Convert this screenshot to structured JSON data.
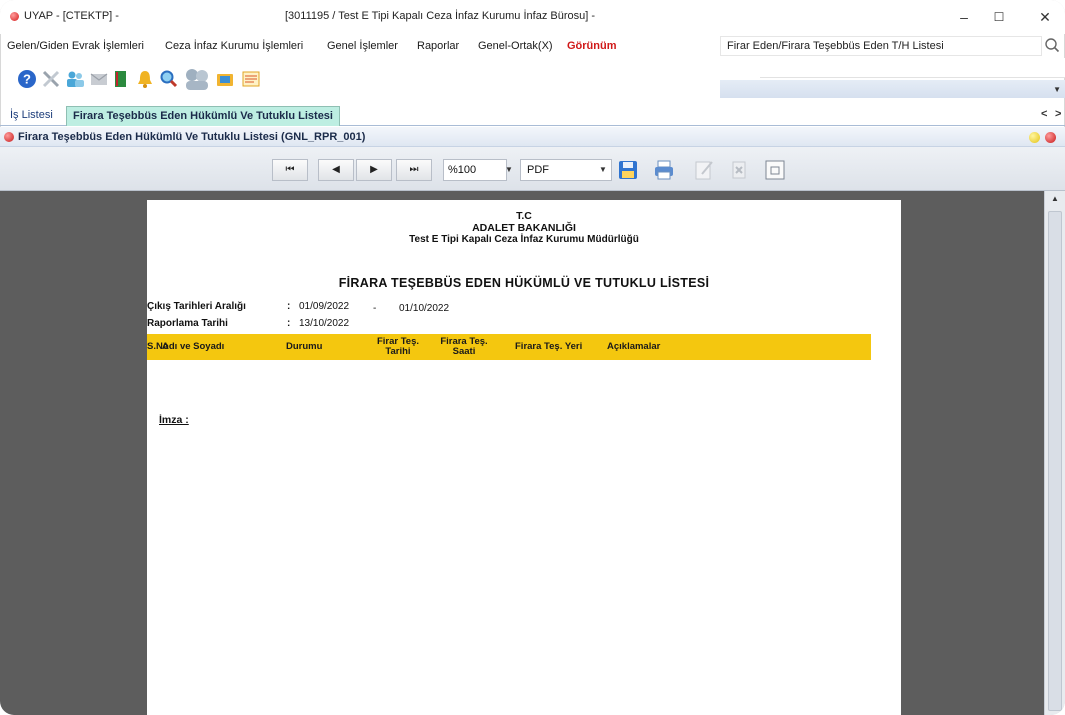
{
  "window": {
    "app_title": "UYAP - [CTEKTP] -",
    "title": "[3011195 / Test E Tipi Kapalı Ceza İnfaz Kurumu İnfaz Bürosu] -",
    "minimize": "–",
    "maximize": "☐",
    "close": "✕"
  },
  "menu": {
    "items": [
      "Gelen/Giden Evrak İşlemleri",
      "Ceza İnfaz Kurumu İşlemleri",
      "Genel İşlemler",
      "Raporlar",
      "Genel-Ortak(X)",
      "Görünüm"
    ],
    "search_value": "Firar Eden/Firara Teşebbüs Eden T/H Listesi"
  },
  "toolbar": {
    "icons": [
      "help-icon",
      "tools-icon",
      "users-icon",
      "mail-icon",
      "book-icon",
      "bell-icon",
      "search-icon",
      "people-icon",
      "folder-icon",
      "notes-icon"
    ]
  },
  "tabs": {
    "items": [
      "İş Listesi",
      "Firara Teşebbüs Eden Hükümlü Ve Tutuklu Listesi"
    ],
    "active_index": 1,
    "scroll_left": "<",
    "scroll_right": ">"
  },
  "panel": {
    "title": "Firara Teşebbüs Eden Hükümlü Ve Tutuklu Listesi (GNL_RPR_001)"
  },
  "report_toolbar": {
    "first": "⏮",
    "prev": "◀",
    "next": "▶",
    "last": "⏭",
    "zoom": "%100",
    "format": "PDF",
    "dropdown_arrow": "▼"
  },
  "report": {
    "header_line1": "T.C",
    "header_line2": "ADALET BAKANLIĞI",
    "header_line3": "Test E Tipi Kapalı Ceza İnfaz Kurumu Müdürlüğü",
    "title": "FİRARA TEŞEBBÜS EDEN HÜKÜMLÜ VE TUTUKLU LİSTESİ",
    "exit_date_label": "Çıkış Tarihleri Aralığı",
    "colon1": ":",
    "exit_date_from": "01/09/2022",
    "dash": "-",
    "exit_date_to": "01/10/2022",
    "report_date_label": "Raporlama Tarihi",
    "colon2": ":",
    "report_date": "13/10/2022",
    "columns": [
      "S.No",
      "Adı ve Soyadı",
      "Durumu",
      "Firar Teş. Tarihi",
      "Firara Teş. Saati",
      "Firara Teş. Yeri",
      "Açıklamalar"
    ],
    "signature": "İmza :"
  },
  "colors": {
    "accent_tab": "#bdeee2",
    "column_band": "#f4c70f",
    "viewer_bg": "#5d5d5d",
    "menu_red": "#d01818"
  }
}
